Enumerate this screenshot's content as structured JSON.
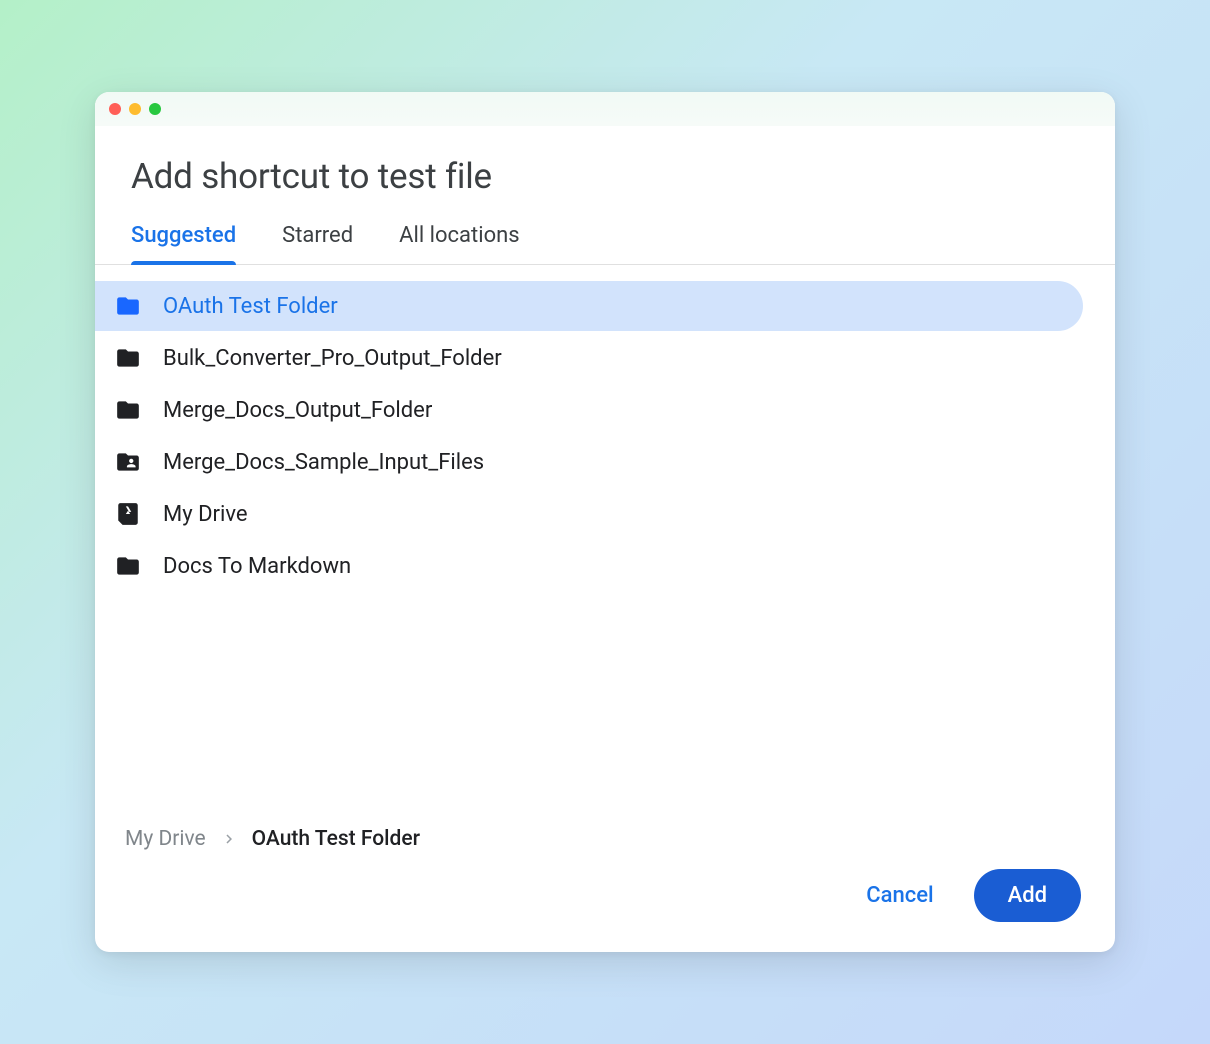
{
  "dialog": {
    "title": "Add shortcut to test file"
  },
  "tabs": [
    {
      "label": "Suggested",
      "active": true
    },
    {
      "label": "Starred",
      "active": false
    },
    {
      "label": "All locations",
      "active": false
    }
  ],
  "items": [
    {
      "label": "OAuth Test Folder",
      "icon": "folder",
      "selected": true
    },
    {
      "label": "Bulk_Converter_Pro_Output_Folder",
      "icon": "folder",
      "selected": false
    },
    {
      "label": "Merge_Docs_Output_Folder",
      "icon": "folder",
      "selected": false
    },
    {
      "label": "Merge_Docs_Sample_Input_Files",
      "icon": "folder-shared",
      "selected": false
    },
    {
      "label": "My Drive",
      "icon": "drive",
      "selected": false
    },
    {
      "label": "Docs To Markdown",
      "icon": "folder",
      "selected": false
    }
  ],
  "breadcrumb": {
    "root": "My Drive",
    "current": "OAuth Test Folder"
  },
  "buttons": {
    "cancel": "Cancel",
    "add": "Add"
  }
}
